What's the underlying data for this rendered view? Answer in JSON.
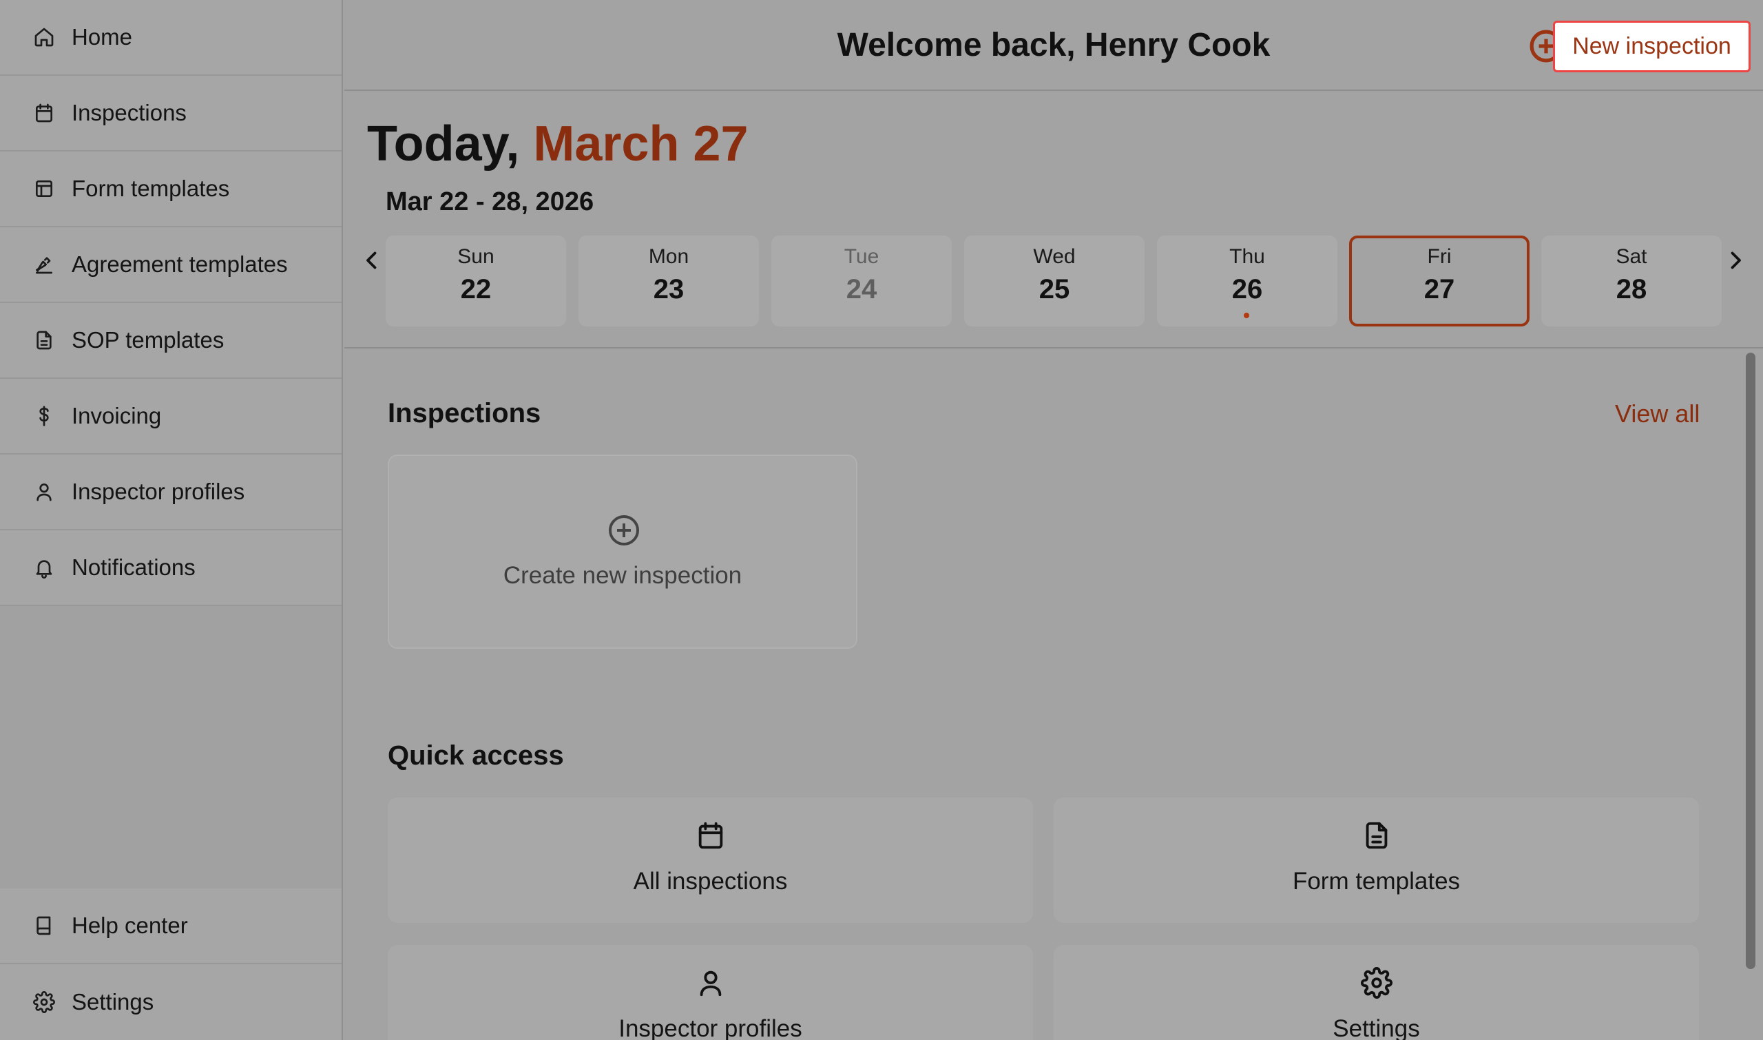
{
  "sidebar": {
    "items": [
      {
        "label": "Home",
        "icon": "home-icon"
      },
      {
        "label": "Inspections",
        "icon": "calendar-icon"
      },
      {
        "label": "Form templates",
        "icon": "layout-icon"
      },
      {
        "label": "Agreement templates",
        "icon": "signature-icon"
      },
      {
        "label": "SOP templates",
        "icon": "file-text-icon"
      },
      {
        "label": "Invoicing",
        "icon": "dollar-icon"
      },
      {
        "label": "Inspector profiles",
        "icon": "user-icon"
      },
      {
        "label": "Notifications",
        "icon": "bell-icon"
      }
    ],
    "bottom_items": [
      {
        "label": "Help center",
        "icon": "book-icon"
      },
      {
        "label": "Settings",
        "icon": "gear-icon"
      }
    ]
  },
  "header": {
    "welcome": "Welcome back, Henry Cook",
    "new_inspection_label": "New inspection"
  },
  "date": {
    "today_prefix": "Today,",
    "today_date": "March 27",
    "week_range": "Mar 22 - 28, 2026",
    "days": [
      {
        "name": "Sun",
        "num": "22"
      },
      {
        "name": "Mon",
        "num": "23"
      },
      {
        "name": "Tue",
        "num": "24",
        "muted": true
      },
      {
        "name": "Wed",
        "num": "25"
      },
      {
        "name": "Thu",
        "num": "26",
        "has_event": true
      },
      {
        "name": "Fri",
        "num": "27",
        "selected": true
      },
      {
        "name": "Sat",
        "num": "28"
      }
    ]
  },
  "inspections": {
    "title": "Inspections",
    "view_all": "View all",
    "create_label": "Create new inspection"
  },
  "quick_access": {
    "title": "Quick access",
    "items": [
      {
        "label": "All inspections",
        "icon": "calendar-icon"
      },
      {
        "label": "Form templates",
        "icon": "file-text-icon"
      },
      {
        "label": "Inspector profiles",
        "icon": "user-icon"
      },
      {
        "label": "Settings",
        "icon": "gear-icon"
      }
    ]
  },
  "colors": {
    "accent": "#9a3412",
    "highlight_border": "#ef4444"
  }
}
